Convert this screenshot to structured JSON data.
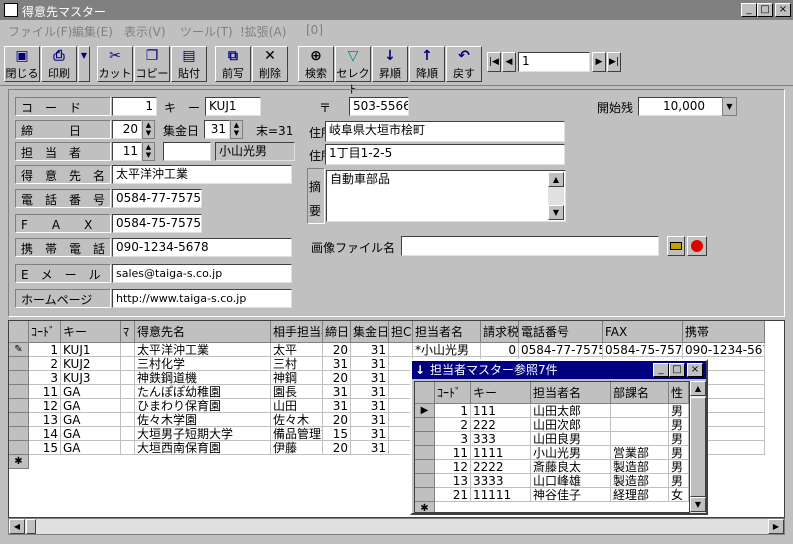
{
  "window": {
    "title": "得意先マスター",
    "min": "_",
    "max": "□",
    "close": "×"
  },
  "menu": [
    "ファイル(F)",
    "編集(E)",
    "表示(V)",
    "ツール(T)",
    "!拡張(A)",
    "[0]"
  ],
  "toolbar": {
    "close": "閉じる",
    "print": "印刷",
    "cut": "カット",
    "copy": "コピー",
    "paste": "貼付",
    "prev_copy": "前写",
    "delete": "削除",
    "search": "検索",
    "select": "セレクト",
    "asc": "昇順",
    "desc": "降順",
    "back": "戻す",
    "record": "1"
  },
  "form": {
    "code_label": "コ　ー　ド",
    "code": "1",
    "key_label": "キ　ー",
    "key": "KUJ1",
    "close_label": "締　　　日",
    "close_day": "20",
    "collect_label": "集金日",
    "collect_day": "31",
    "end_label": "末=31",
    "staff_label": "担　当　者",
    "staff_no": "11",
    "staff_name": "小山光男",
    "customer_label": "得　意　先　名",
    "customer": "太平洋沖工業",
    "phone_label": "電　話　番　号",
    "phone": "0584-77-7575",
    "fax_label": "F　　A　　X",
    "fax": "0584-75-7575",
    "mobile_label": "携　帯　電　話",
    "mobile": "090-1234-5678",
    "email_label": "E　メ　ー　ル",
    "email": "sales@taiga-s.co.jp",
    "home_label": "ホームページ",
    "home": "http://www.taiga-s.co.jp",
    "zip_label": "〒",
    "zip": "503-5566",
    "addr1_label": "住所１",
    "addr1": "岐阜県大垣市桧町",
    "addr2_label": "住所２",
    "addr2": "1丁目1-2-5",
    "memo_label1": "摘",
    "memo_label2": "要",
    "memo": "自動車部品",
    "image_label": "画像ファイル名",
    "image": "",
    "start_label": "開始残",
    "start": "10,000"
  },
  "grid": {
    "headers": [
      "ｺｰﾄﾞ",
      "キー",
      "ﾏ",
      "得意先名",
      "相手担当者",
      "締日",
      "集金日",
      "担C",
      "担当者名",
      "請求税",
      "電話番号",
      "FAX",
      "携帯"
    ],
    "rows": [
      [
        "1",
        "KUJ1",
        "",
        "太平洋沖工業",
        "太平",
        "20",
        "31",
        "",
        "*小山光男",
        "0",
        "0584-77-7575",
        "0584-75-7575",
        "090-1234-5678"
      ],
      [
        "2",
        "KUJ2",
        "",
        "三村化学",
        "三村",
        "31",
        "31",
        "",
        "",
        "",
        "",
        "",
        ""
      ],
      [
        "3",
        "KUJ3",
        "",
        "神鉄鋼道機",
        "神鋼",
        "20",
        "31",
        "",
        "",
        "",
        "",
        "",
        ""
      ],
      [
        "11",
        "GA",
        "",
        "たんぽぽ幼稚園",
        "園長",
        "31",
        "31",
        "",
        "",
        "",
        "",
        "",
        ""
      ],
      [
        "12",
        "GA",
        "",
        "ひまわり保育園",
        "山田",
        "31",
        "31",
        "",
        "",
        "",
        "",
        "",
        ""
      ],
      [
        "13",
        "GA",
        "",
        "佐々木学園",
        "佐々木",
        "20",
        "31",
        "",
        "",
        "",
        "",
        "",
        ""
      ],
      [
        "14",
        "GA",
        "",
        "大垣男子短期大学",
        "備品管理課",
        "15",
        "31",
        "",
        "",
        "",
        "",
        "",
        ""
      ],
      [
        "15",
        "GA",
        "",
        "大垣西南保育園",
        "伊藤",
        "20",
        "31",
        "",
        "",
        "",
        "",
        "",
        ""
      ]
    ]
  },
  "popup": {
    "title": "担当者マスター参照7件",
    "headers": [
      "ｺｰﾄﾞ",
      "キー",
      "担当者名",
      "部課名",
      "性"
    ],
    "rows": [
      [
        "1",
        "111",
        "山田太郎",
        "",
        "男"
      ],
      [
        "2",
        "222",
        "山田次郎",
        "",
        "男"
      ],
      [
        "3",
        "333",
        "山田良男",
        "",
        "男"
      ],
      [
        "11",
        "1111",
        "小山光男",
        "営業部",
        "男"
      ],
      [
        "12",
        "2222",
        "斎藤良太",
        "製造部",
        "男"
      ],
      [
        "13",
        "3333",
        "山口峰雄",
        "製造部",
        "男"
      ],
      [
        "21",
        "11111",
        "神谷佳子",
        "経理部",
        "女"
      ]
    ]
  }
}
